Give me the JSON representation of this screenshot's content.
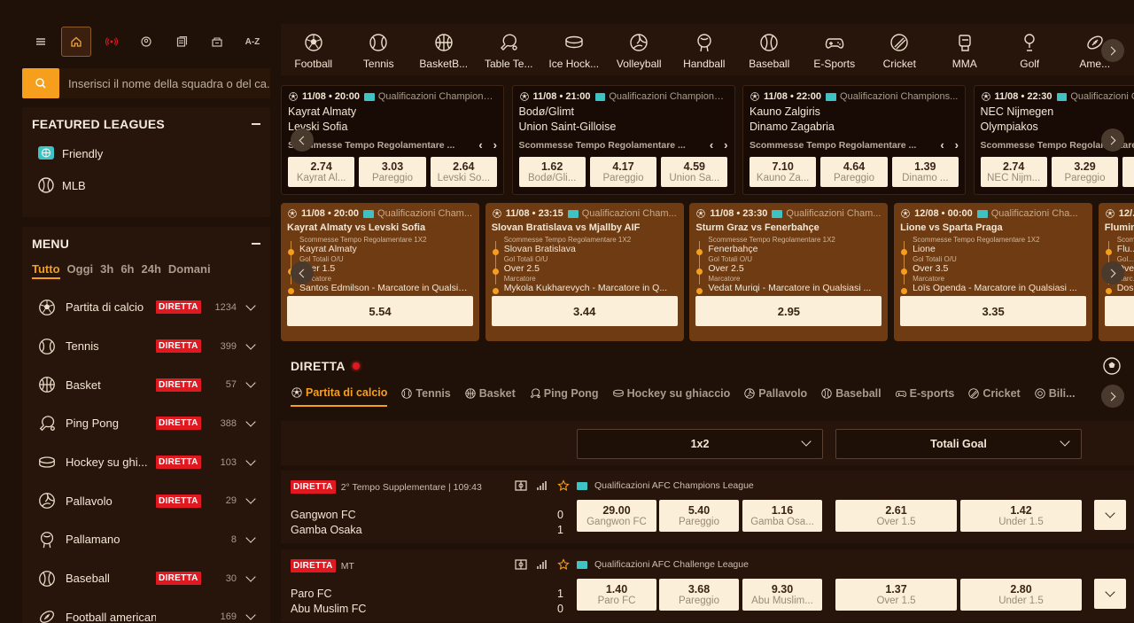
{
  "top_icons": [
    {
      "name": "menu-icon"
    },
    {
      "name": "home-icon",
      "active": true
    },
    {
      "name": "live-broadcast-icon"
    },
    {
      "name": "user-circle-icon"
    },
    {
      "name": "betslip-icon"
    },
    {
      "name": "casino-icon"
    },
    {
      "name": "a-z-icon",
      "text": "A-Z"
    }
  ],
  "search": {
    "placeholder": "Inserisci il nome della squadra o del ca..."
  },
  "featured": {
    "title": "FEATURED LEAGUES",
    "items": [
      {
        "label": "Friendly",
        "icon": "globe-icon"
      },
      {
        "label": "MLB",
        "icon": "baseball-icon"
      }
    ]
  },
  "menu": {
    "title": "MENU",
    "time_filters": [
      "Tutto",
      "Oggi",
      "3h",
      "6h",
      "24h",
      "Domani"
    ],
    "sports": [
      {
        "label": "Partita di calcio",
        "live": "DIRETTA",
        "count": "1234",
        "icon": "soccer-ball-icon"
      },
      {
        "label": "Tennis",
        "live": "DIRETTA",
        "count": "399",
        "icon": "tennis-ball-icon"
      },
      {
        "label": "Basket",
        "live": "DIRETTA",
        "count": "57",
        "icon": "basketball-icon"
      },
      {
        "label": "Ping Pong",
        "live": "DIRETTA",
        "count": "388",
        "icon": "ping-pong-icon"
      },
      {
        "label": "Hockey su ghi...",
        "live": "DIRETTA",
        "count": "103",
        "icon": "hockey-puck-icon"
      },
      {
        "label": "Pallavolo",
        "live": "DIRETTA",
        "count": "29",
        "icon": "volleyball-icon"
      },
      {
        "label": "Pallamano",
        "live": "",
        "count": "8",
        "icon": "handball-icon"
      },
      {
        "label": "Baseball",
        "live": "DIRETTA",
        "count": "30",
        "icon": "baseball-icon"
      },
      {
        "label": "Football americano",
        "live": "",
        "count": "169",
        "icon": "american-football-icon"
      }
    ]
  },
  "sports_nav": [
    {
      "label": "Football",
      "icon": "soccer-ball-icon"
    },
    {
      "label": "Tennis",
      "icon": "tennis-ball-icon"
    },
    {
      "label": "BasketB...",
      "icon": "basketball-icon"
    },
    {
      "label": "Table Te...",
      "icon": "ping-pong-icon"
    },
    {
      "label": "Ice Hock...",
      "icon": "hockey-puck-icon"
    },
    {
      "label": "Volleyball",
      "icon": "volleyball-icon"
    },
    {
      "label": "Handball",
      "icon": "handball-icon"
    },
    {
      "label": "Baseball",
      "icon": "baseball-icon"
    },
    {
      "label": "E-Sports",
      "icon": "gamepad-icon"
    },
    {
      "label": "Cricket",
      "icon": "cricket-icon"
    },
    {
      "label": "MMA",
      "icon": "mma-glove-icon"
    },
    {
      "label": "Golf",
      "icon": "golf-icon"
    },
    {
      "label": "Ame...",
      "icon": "american-football-icon"
    }
  ],
  "featured_matches": [
    {
      "datetime": "11/08 • 20:00",
      "competition": "Qualificazioni Champions ...",
      "home": "Kayrat Almaty",
      "away": "Levski Sofia",
      "market": "Scommesse Tempo Regolamentare ...",
      "odds": [
        {
          "v": "2.74",
          "l": "Kayrat Al..."
        },
        {
          "v": "3.03",
          "l": "Pareggio"
        },
        {
          "v": "2.64",
          "l": "Levski So..."
        }
      ]
    },
    {
      "datetime": "11/08 • 21:00",
      "competition": "Qualificazioni Champions ...",
      "home": "Bodø/Glimt",
      "away": "Union Saint-Gilloise",
      "market": "Scommesse Tempo Regolamentare ...",
      "odds": [
        {
          "v": "1.62",
          "l": "Bodø/Gli..."
        },
        {
          "v": "4.17",
          "l": "Pareggio"
        },
        {
          "v": "4.59",
          "l": "Union Sa..."
        }
      ]
    },
    {
      "datetime": "11/08 • 22:00",
      "competition": "Qualificazioni Champions...",
      "home": "Kauno Zalgiris",
      "away": "Dinamo Zagabria",
      "market": "Scommesse Tempo Regolamentare ...",
      "odds": [
        {
          "v": "7.10",
          "l": "Kauno Za..."
        },
        {
          "v": "4.64",
          "l": "Pareggio"
        },
        {
          "v": "1.39",
          "l": "Dinamo ..."
        }
      ]
    },
    {
      "datetime": "11/08 • 22:30",
      "competition": "Qualificazioni Champions ...",
      "home": "NEC Nijmegen",
      "away": "Olympiakos",
      "market": "Scommesse Tempo Regolamentare ...",
      "odds": [
        {
          "v": "2.74",
          "l": "NEC Nijm..."
        },
        {
          "v": "3.29",
          "l": "Pareggio"
        },
        {
          "v": "",
          "l": ""
        }
      ]
    }
  ],
  "bet_builders": [
    {
      "datetime": "11/08 • 20:00",
      "competition": "Qualificazioni Cham...",
      "title": "Kayrat Almaty vs Levski Sofia",
      "legs": [
        {
          "k": "Scommesse Tempo Regolamentare 1X2",
          "v": "Kayrat Almaty"
        },
        {
          "k": "Gol Totali O/U",
          "v": "Over 1.5"
        },
        {
          "k": "Marcatore",
          "v": "Santos Edmilson - Marcatore in Qualsiasi ..."
        }
      ],
      "odd": "5.54"
    },
    {
      "datetime": "11/08 • 23:15",
      "competition": "Qualificazioni Cham...",
      "title": "Slovan Bratislava vs Mjallby AIF",
      "legs": [
        {
          "k": "Scommesse Tempo Regolamentare 1X2",
          "v": "Slovan Bratislava"
        },
        {
          "k": "Gol Totali O/U",
          "v": "Over 2.5"
        },
        {
          "k": "Marcatore",
          "v": "Mykola Kukharevych - Marcatore in Q..."
        }
      ],
      "odd": "3.44"
    },
    {
      "datetime": "11/08 • 23:30",
      "competition": "Qualificazioni Cham...",
      "title": "Sturm Graz vs Fenerbahçe",
      "legs": [
        {
          "k": "Scommesse Tempo Regolamentare 1X2",
          "v": "Fenerbahçe"
        },
        {
          "k": "Gol Totali O/U",
          "v": "Over 2.5"
        },
        {
          "k": "Marcatore",
          "v": "Vedat Muriqi - Marcatore in Qualsiasi ..."
        }
      ],
      "odd": "2.95"
    },
    {
      "datetime": "12/08 • 00:00",
      "competition": "Qualificazioni Cha...",
      "title": "Lione vs Sparta Praga",
      "legs": [
        {
          "k": "Scommesse Tempo Regolamentare 1X2",
          "v": "Lione"
        },
        {
          "k": "Gol Totali O/U",
          "v": "Over 3.5"
        },
        {
          "k": "Marcatore",
          "v": "Loïs Openda - Marcatore in Qualsiasi ..."
        }
      ],
      "odd": "3.35"
    },
    {
      "datetime": "12/...",
      "competition": "",
      "title": "Flumin...",
      "legs": [
        {
          "k": "Scom...",
          "v": "Flu..."
        },
        {
          "k": "Gol...",
          "v": "Ove..."
        },
        {
          "k": "Marc...",
          "v": "Dos..."
        }
      ],
      "odd": ""
    }
  ],
  "live": {
    "title": "DIRETTA",
    "tabs": [
      {
        "label": "Partita di calcio",
        "icon": "soccer-ball-icon"
      },
      {
        "label": "Tennis",
        "icon": "tennis-ball-icon"
      },
      {
        "label": "Basket",
        "icon": "basketball-icon"
      },
      {
        "label": "Ping Pong",
        "icon": "ping-pong-icon"
      },
      {
        "label": "Hockey su ghiaccio",
        "icon": "hockey-puck-icon"
      },
      {
        "label": "Pallavolo",
        "icon": "volleyball-icon"
      },
      {
        "label": "Baseball",
        "icon": "baseball-icon"
      },
      {
        "label": "E-sports",
        "icon": "gamepad-icon"
      },
      {
        "label": "Cricket",
        "icon": "cricket-icon"
      },
      {
        "label": "Bili...",
        "icon": "billiards-icon"
      }
    ],
    "market_select_1": "1x2",
    "market_select_2": "Totali Goal",
    "events": [
      {
        "badge": "DIRETTA",
        "status": "2° Tempo Supplementare | 109:43",
        "competition": "Qualificazioni AFC Champions League",
        "home": "Gangwon FC",
        "away": "Gamba Osaka",
        "home_score": "0",
        "away_score": "1",
        "odds": [
          {
            "v": "29.00",
            "l": "Gangwon FC"
          },
          {
            "v": "5.40",
            "l": "Pareggio"
          },
          {
            "v": "1.16",
            "l": "Gamba Osa..."
          }
        ],
        "totals": [
          {
            "v": "2.61",
            "l": "Over 1.5"
          },
          {
            "v": "1.42",
            "l": "Under 1.5"
          }
        ]
      },
      {
        "badge": "DIRETTA",
        "status": "MT",
        "competition": "Qualificazioni AFC Challenge League",
        "home": "Paro FC",
        "away": "Abu Muslim FC",
        "home_score": "1",
        "away_score": "0",
        "odds": [
          {
            "v": "1.40",
            "l": "Paro FC"
          },
          {
            "v": "3.68",
            "l": "Pareggio"
          },
          {
            "v": "9.30",
            "l": "Abu Muslim..."
          }
        ],
        "totals": [
          {
            "v": "1.37",
            "l": "Over 1.5"
          },
          {
            "v": "2.80",
            "l": "Under 1.5"
          }
        ]
      }
    ]
  },
  "colors": {
    "accent": "#f59f1c",
    "live_red": "#e01820",
    "odds_bg": "#fcefd9",
    "panel": "#27140a",
    "bet_builder": "#6e3b13"
  }
}
